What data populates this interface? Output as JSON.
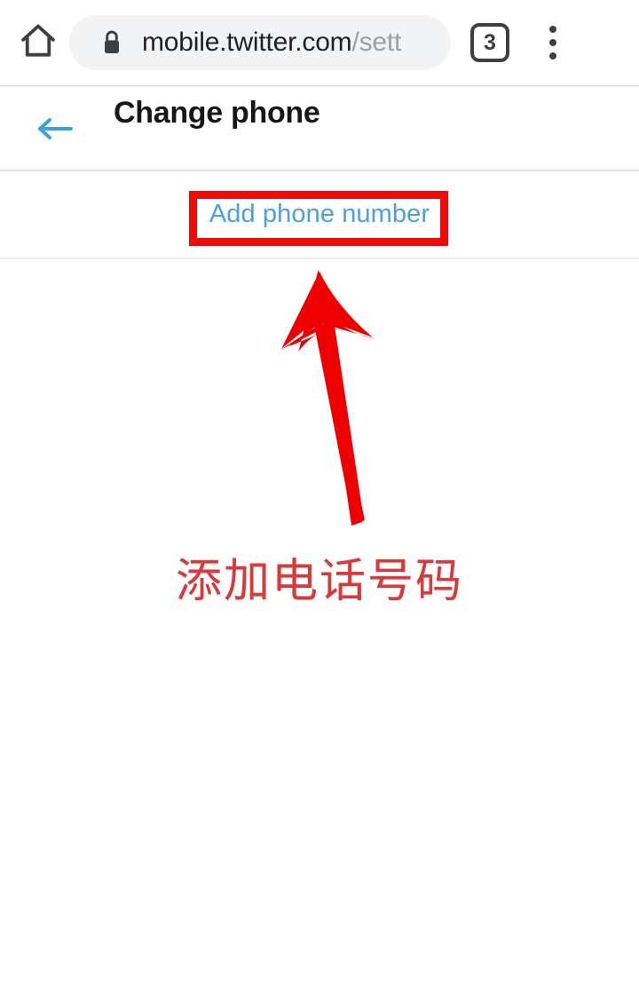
{
  "browser": {
    "home_icon": "home-icon",
    "lock_icon": "lock-icon",
    "url_host": "mobile.twitter.com",
    "url_path": "/sett",
    "tab_count": "3",
    "menu_icon": "overflow-menu-icon"
  },
  "page": {
    "back_icon": "back-arrow-icon",
    "title": "Change phone"
  },
  "main": {
    "add_phone_label": "Add phone number"
  },
  "annotations": {
    "highlight_color": "#f00a0a",
    "arrow_color": "#ee0000",
    "caption": "添加电话号码",
    "caption_color": "#d63a3a"
  },
  "colors": {
    "link_blue": "#4aa0e0",
    "title_black": "#14171a",
    "url_gray": "#9aa0a6",
    "chrome_gray": "#f1f3f4"
  }
}
